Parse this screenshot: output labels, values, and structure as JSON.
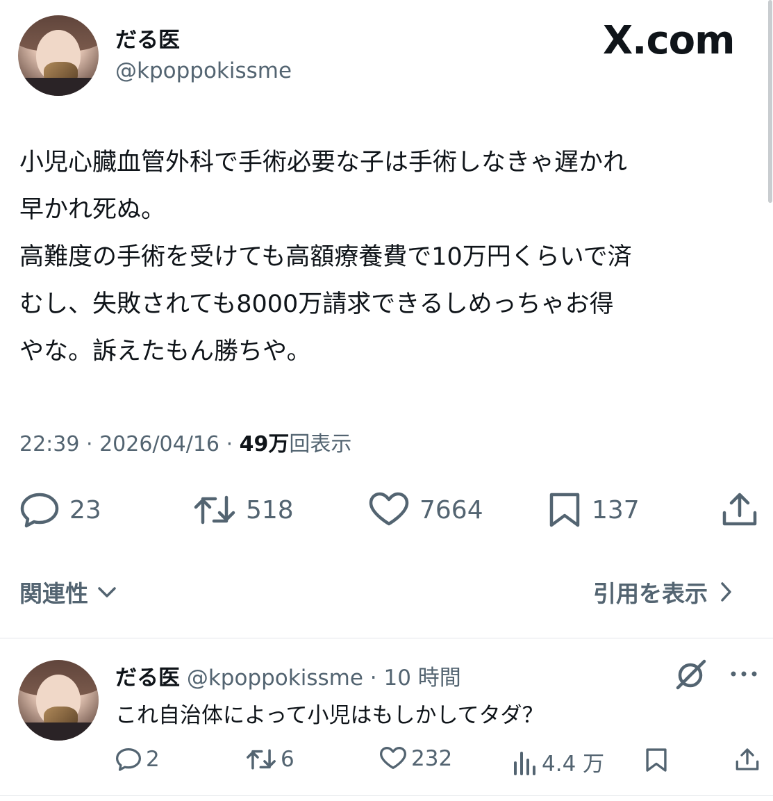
{
  "main": {
    "display_name": "だる医",
    "handle": "@kpoppokissme",
    "watermark": "X.com",
    "text": "小児心臓血管外科で手術必要な子は手術しなきゃ遅かれ\n早かれ死ぬ。\n高難度の手術を受けても高額療養費で10万円くらいで済\nむし、失敗されても8000万請求できるしめっちゃお得\nやな。訴えたもん勝ちや。",
    "time": "22:39",
    "date": "2026/04/16",
    "views_count": "49万",
    "views_label": "回表示",
    "replies": "23",
    "reposts": "518",
    "likes": "7664",
    "bookmarks": "137",
    "related_label": "関連性",
    "quotes_label": "引用を表示"
  },
  "reply": {
    "display_name": "だる医",
    "handle": "@kpoppokissme",
    "time_ago": "10 時間",
    "text": "これ自治体によって小児はもしかしてタダ？",
    "replies": "2",
    "reposts": "6",
    "likes": "232",
    "views": "4.4 万"
  },
  "colors": {
    "text": "#0f1419",
    "muted": "#536471",
    "divider": "#e1e5e8"
  },
  "icons": [
    "reply-icon",
    "repost-icon",
    "like-icon",
    "bookmark-icon",
    "share-icon",
    "chevron-down-icon",
    "chevron-right-icon",
    "grok-icon",
    "more-icon",
    "views-icon"
  ]
}
